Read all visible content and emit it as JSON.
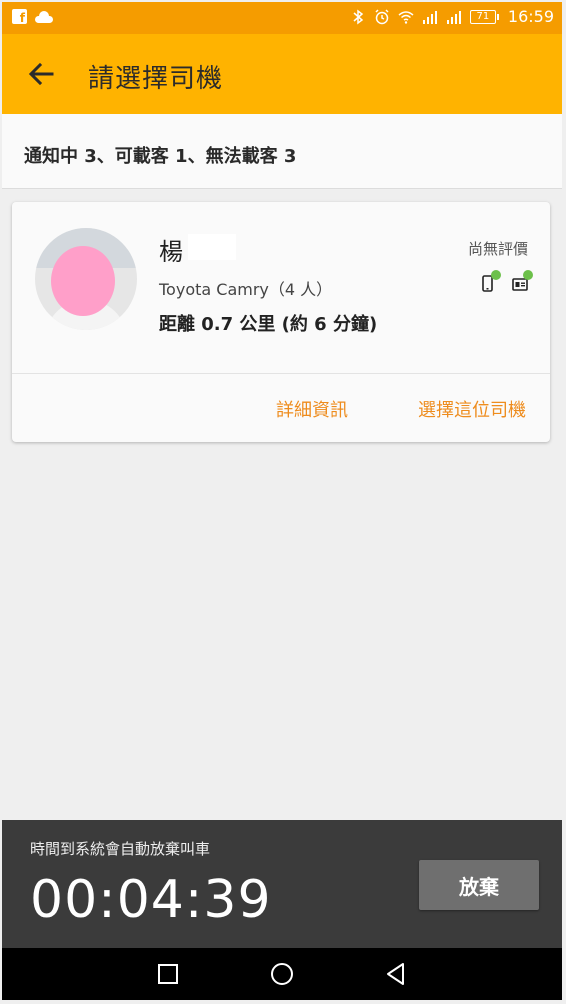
{
  "status_bar": {
    "battery_level": "71",
    "time": "16:59",
    "left_icons": [
      "facebook-icon",
      "cloud-icon"
    ],
    "right_icons": [
      "bluetooth-icon",
      "alarm-icon",
      "wifi-icon",
      "signal-icon",
      "signal-icon"
    ]
  },
  "header": {
    "title": "請選擇司機",
    "back_icon": "back-arrow-icon"
  },
  "summary": {
    "text": "通知中 3、可載客 1、無法載客 3"
  },
  "driver": {
    "name": "楊",
    "rating": "尚無評價",
    "car": "Toyota Camry（4 人）",
    "distance": "距離 0.7 公里 (約 6 分鐘)",
    "badges": [
      "phone-verified-icon",
      "id-verified-icon"
    ],
    "details_label": "詳細資訊",
    "select_label": "選擇這位司機"
  },
  "countdown": {
    "message": "時間到系統會自動放棄叫車",
    "time": "00:04:39",
    "cancel_label": "放棄"
  },
  "colors": {
    "status_bar": "#f59c00",
    "app_bar": "#ffb300",
    "action_text": "#ee8c1d",
    "bottom_panel": "#3b3b3b"
  }
}
